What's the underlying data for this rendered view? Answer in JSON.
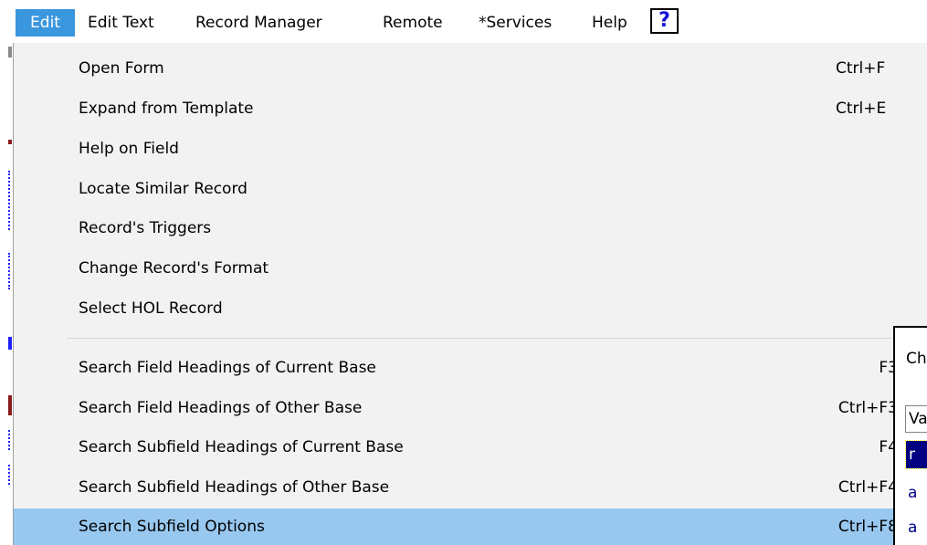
{
  "menubar": {
    "items": [
      {
        "label": "Edit",
        "active": true
      },
      {
        "label": "Edit Text"
      },
      {
        "label": "Record Manager"
      },
      {
        "label": "Remote"
      },
      {
        "label": "*Services"
      },
      {
        "label": "Help"
      }
    ],
    "help_icon": "?"
  },
  "menu": {
    "items": [
      {
        "label": "Open Form",
        "shortcut": "Ctrl+F"
      },
      {
        "label": "Expand from Template",
        "shortcut": "Ctrl+E"
      },
      {
        "label": "Help on Field",
        "shortcut": ""
      },
      {
        "label": "Locate Similar Record",
        "shortcut": ""
      },
      {
        "label": "Record's Triggers",
        "shortcut": ""
      },
      {
        "label": "Change Record's Format",
        "shortcut": ""
      },
      {
        "label": "Select HOL Record",
        "shortcut": ""
      },
      {
        "label": "Search Field Headings of Current Base",
        "shortcut": "F3"
      },
      {
        "label": "Search Field Headings of Other Base",
        "shortcut": "Ctrl+F3"
      },
      {
        "label": "Search Subfield Headings of Current Base",
        "shortcut": "F4"
      },
      {
        "label": "Search Subfield Headings of Other Base",
        "shortcut": "Ctrl+F4"
      },
      {
        "label": "Search Subfield Options",
        "shortcut": "Ctrl+F8",
        "highlighted": true
      }
    ]
  },
  "dialog": {
    "title": "Ch",
    "header": "Va",
    "rows": [
      "r",
      "a",
      "a"
    ]
  },
  "colors": {
    "menubar_active": "#3a96dd",
    "menu_background": "#f2f2f2",
    "menu_highlight": "#98c8f0",
    "help_icon": "#1414d8",
    "dialog_selection": "#000080",
    "dialog_text": "#00008a"
  }
}
